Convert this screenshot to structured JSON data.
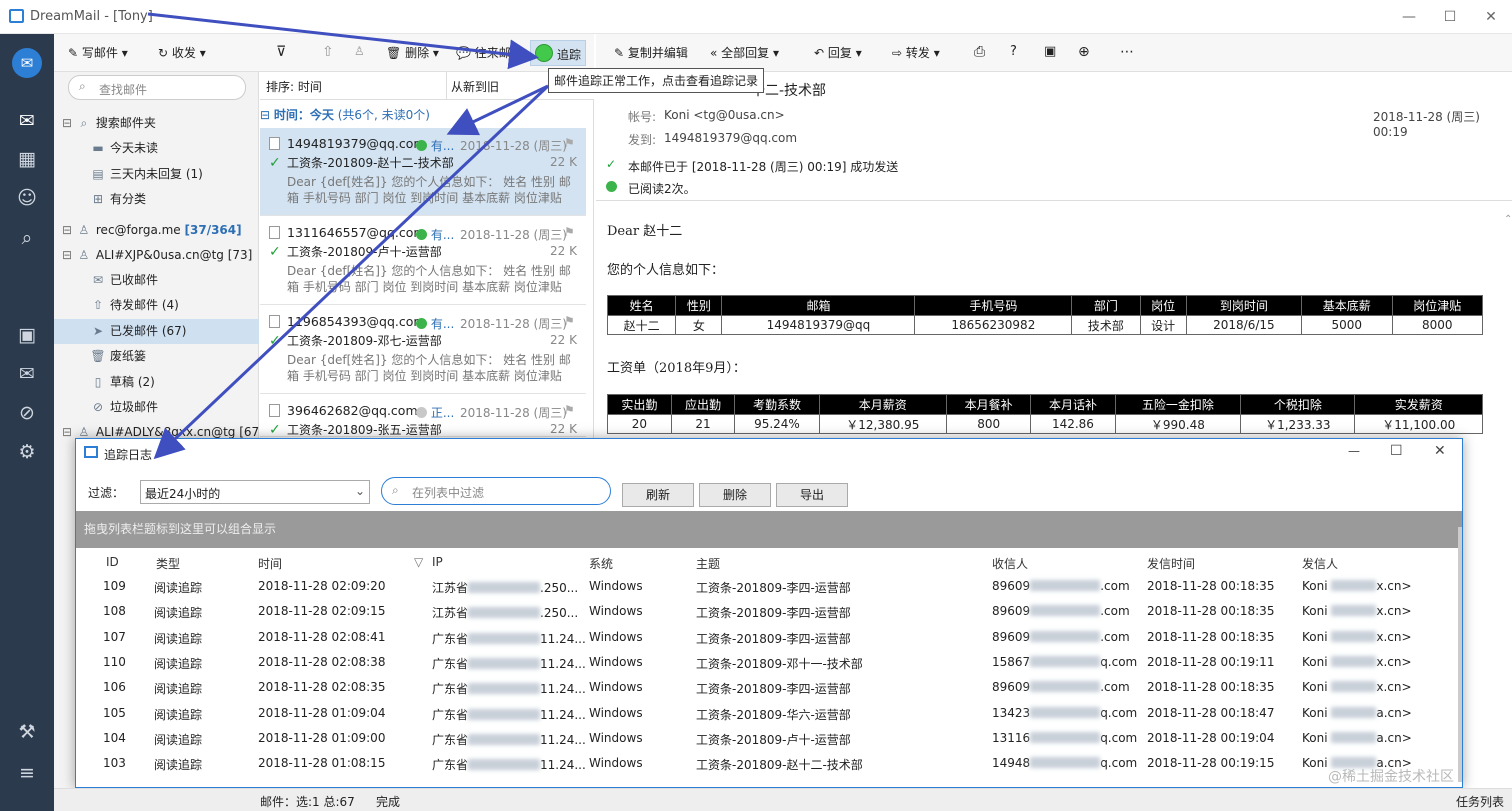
{
  "window": {
    "title": "DreamMail - [Tony]"
  },
  "colors": {
    "accent": "#2d7fd6",
    "sidebar": "#2b3a4d",
    "arrow": "#3f4fbf",
    "success": "#21a038"
  },
  "sidebar_icons": [
    "mail-icon",
    "calendar-icon",
    "contacts-icon",
    "search-icon",
    "address-book-icon",
    "mail-track-icon",
    "attachment-icon",
    "settings-icon",
    "tools-icon",
    "menu-icon"
  ],
  "toolbar": {
    "compose": "写邮件",
    "sendrecv": "收发",
    "delete": "删除",
    "conversation": "往来邮件",
    "track": "追踪"
  },
  "search": {
    "placeholder": "查找邮件"
  },
  "folders": [
    {
      "label": "搜索邮件夹"
    },
    {
      "label": "今天未读"
    },
    {
      "label": "三天内未回复 (1)"
    },
    {
      "label": "有分类"
    },
    {
      "label": "rec@forga.me",
      "count": "[37/364]"
    },
    {
      "label": "ALI#XJP&0usa.cn@tg [73]"
    },
    {
      "label": "已收邮件"
    },
    {
      "label": "待发邮件 (4)"
    },
    {
      "label": "已发邮件 (67)"
    },
    {
      "label": "废纸篓"
    },
    {
      "label": "草稿 (2)"
    },
    {
      "label": "垃圾邮件"
    },
    {
      "label": "ALI#ADLY&8qxx.cn@tg [67]"
    }
  ],
  "list": {
    "sort_label": "排序: 时间",
    "sort_order": "从新到旧",
    "group": "时间：今天",
    "group_count": "(共6个, 未读0个)",
    "messages": [
      {
        "from": "1494819379@qq.com",
        "status": "有...",
        "date": "2018-11-28 (周三)",
        "subject": "工资条-201809-赵十二-技术部",
        "size": "22 K",
        "preview": "Dear {def[姓名]} 您的个人信息如下： 姓名 性别 邮箱 手机号码 部门 岗位 到岗时间 基本底薪 岗位津贴 {def..."
      },
      {
        "from": "1311646557@qq.com",
        "status": "有...",
        "date": "2018-11-28 (周三)",
        "subject": "工资条-201809-卢十-运营部",
        "size": "22 K",
        "preview": "Dear {def[姓名]} 您的个人信息如下： 姓名 性别 邮箱 手机号码 部门 岗位 到岗时间 基本底薪 岗位津贴 {def..."
      },
      {
        "from": "1196854393@qq.com",
        "status": "有...",
        "date": "2018-11-28 (周三)",
        "subject": "工资条-201809-邓七-运营部",
        "size": "22 K",
        "preview": "Dear {def[姓名]} 您的个人信息如下： 姓名 性别 邮箱 手机号码 部门 岗位 到岗时间 基本底薪 岗位津贴 {def..."
      },
      {
        "from": "396462682@qq.com",
        "status": "正...",
        "date": "2018-11-28 (周三)",
        "subject": "工资条-201809-张五-运营部",
        "size": "22 K",
        "preview": ""
      }
    ]
  },
  "tooltip": "邮件追踪正常工作，点击查看追踪记录",
  "reading": {
    "toolbar": {
      "copy_edit": "复制并编辑",
      "reply_all": "全部回复",
      "reply": "回复",
      "forward": "转发"
    },
    "subject": "工资条-201809-赵十二-技术部",
    "subject_visible": "十二-技术部",
    "account_label": "帐号:",
    "account": "Koni <tg@0usa.cn>",
    "to_label": "发到:",
    "to": "1494819379@qq.com",
    "date": "2018-11-28 (周三) 00:19",
    "sent_note": "本邮件已于 [2018-11-28 (周三) 00:19] 成功发送",
    "read_note": "已阅读2次。",
    "greeting": "Dear 赵十二",
    "info_title": "您的个人信息如下：",
    "info_headers": [
      "姓名",
      "性别",
      "邮箱",
      "手机号码",
      "部门",
      "岗位",
      "到岗时间",
      "基本底薪",
      "岗位津贴"
    ],
    "info_row": [
      "赵十二",
      "女",
      "1494819379@qq",
      "18656230982",
      "技术部",
      "设计",
      "2018/6/15",
      "5000",
      "8000"
    ],
    "pay_title": "工资单（2018年9月）：",
    "pay_headers": [
      "实出勤",
      "应出勤",
      "考勤系数",
      "本月薪资",
      "本月餐补",
      "本月话补",
      "五险一金扣除",
      "个税扣除",
      "实发薪资"
    ],
    "pay_row": [
      "20",
      "21",
      "95.24%",
      "￥12,380.95",
      "800",
      "142.86",
      "￥990.48",
      "￥1,233.33",
      "￥11,100.00"
    ]
  },
  "dialog": {
    "title": "追踪日志",
    "filter_label": "过滤：",
    "filter_value": "最近24小时的",
    "filter_placeholder": "在列表中过滤",
    "buttons": {
      "refresh": "刷新",
      "delete": "删除",
      "export": "导出"
    },
    "group_hint": "拖曳列表栏题标到这里可以组合显示",
    "columns": [
      "ID",
      "类型",
      "时间",
      "IP",
      "系统",
      "主题",
      "收信人",
      "发信时间",
      "发信人"
    ],
    "rows": [
      {
        "id": "109",
        "type": "阅读追踪",
        "time": "2018-11-28 02:09:20",
        "ip_a": "江苏省",
        "ip_b": ".250...",
        "os": "Windows",
        "subject": "工资条-201809-李四-运营部",
        "to_a": "89609",
        "to_b": ".com",
        "sent": "2018-11-28 00:18:35",
        "from_a": "Koni",
        "from_b": "x.cn>"
      },
      {
        "id": "108",
        "type": "阅读追踪",
        "time": "2018-11-28 02:09:15",
        "ip_a": "江苏省",
        "ip_b": ".250...",
        "os": "Windows",
        "subject": "工资条-201809-李四-运营部",
        "to_a": "89609",
        "to_b": ".com",
        "sent": "2018-11-28 00:18:35",
        "from_a": "Koni",
        "from_b": "x.cn>"
      },
      {
        "id": "107",
        "type": "阅读追踪",
        "time": "2018-11-28 02:08:41",
        "ip_a": "广东省",
        "ip_b": "11.24...",
        "os": "Windows",
        "subject": "工资条-201809-李四-运营部",
        "to_a": "89609",
        "to_b": ".com",
        "sent": "2018-11-28 00:18:35",
        "from_a": "Koni",
        "from_b": "x.cn>"
      },
      {
        "id": "110",
        "type": "阅读追踪",
        "time": "2018-11-28 02:08:38",
        "ip_a": "广东省",
        "ip_b": "11.24...",
        "os": "Windows",
        "subject": "工资条-201809-邓十一-技术部",
        "to_a": "15867",
        "to_b": "q.com",
        "sent": "2018-11-28 00:19:11",
        "from_a": "Koni",
        "from_b": "x.cn>"
      },
      {
        "id": "106",
        "type": "阅读追踪",
        "time": "2018-11-28 02:08:35",
        "ip_a": "广东省",
        "ip_b": "11.24...",
        "os": "Windows",
        "subject": "工资条-201809-李四-运营部",
        "to_a": "89609",
        "to_b": ".com",
        "sent": "2018-11-28 00:18:35",
        "from_a": "Koni",
        "from_b": "x.cn>"
      },
      {
        "id": "105",
        "type": "阅读追踪",
        "time": "2018-11-28 01:09:04",
        "ip_a": "广东省",
        "ip_b": "11.24...",
        "os": "Windows",
        "subject": "工资条-201809-华六-运营部",
        "to_a": "13423",
        "to_b": "q.com",
        "sent": "2018-11-28 00:18:47",
        "from_a": "Koni",
        "from_b": "a.cn>"
      },
      {
        "id": "104",
        "type": "阅读追踪",
        "time": "2018-11-28 01:09:00",
        "ip_a": "广东省",
        "ip_b": "11.24...",
        "os": "Windows",
        "subject": "工资条-201809-卢十-运营部",
        "to_a": "13116",
        "to_b": "q.com",
        "sent": "2018-11-28 00:19:04",
        "from_a": "Koni",
        "from_b": "a.cn>"
      },
      {
        "id": "103",
        "type": "阅读追踪",
        "time": "2018-11-28 01:08:15",
        "ip_a": "广东省",
        "ip_b": "11.24...",
        "os": "Windows",
        "subject": "工资条-201809-赵十二-技术部",
        "to_a": "14948",
        "to_b": "q.com",
        "sent": "2018-11-28 00:19:15",
        "from_a": "Koni",
        "from_b": "a.cn>"
      }
    ]
  },
  "statusbar": {
    "mail_count": "邮件：选:1 总:67",
    "state": "完成",
    "tasks": "任务列表"
  },
  "watermark": "@稀土掘金技术社区"
}
